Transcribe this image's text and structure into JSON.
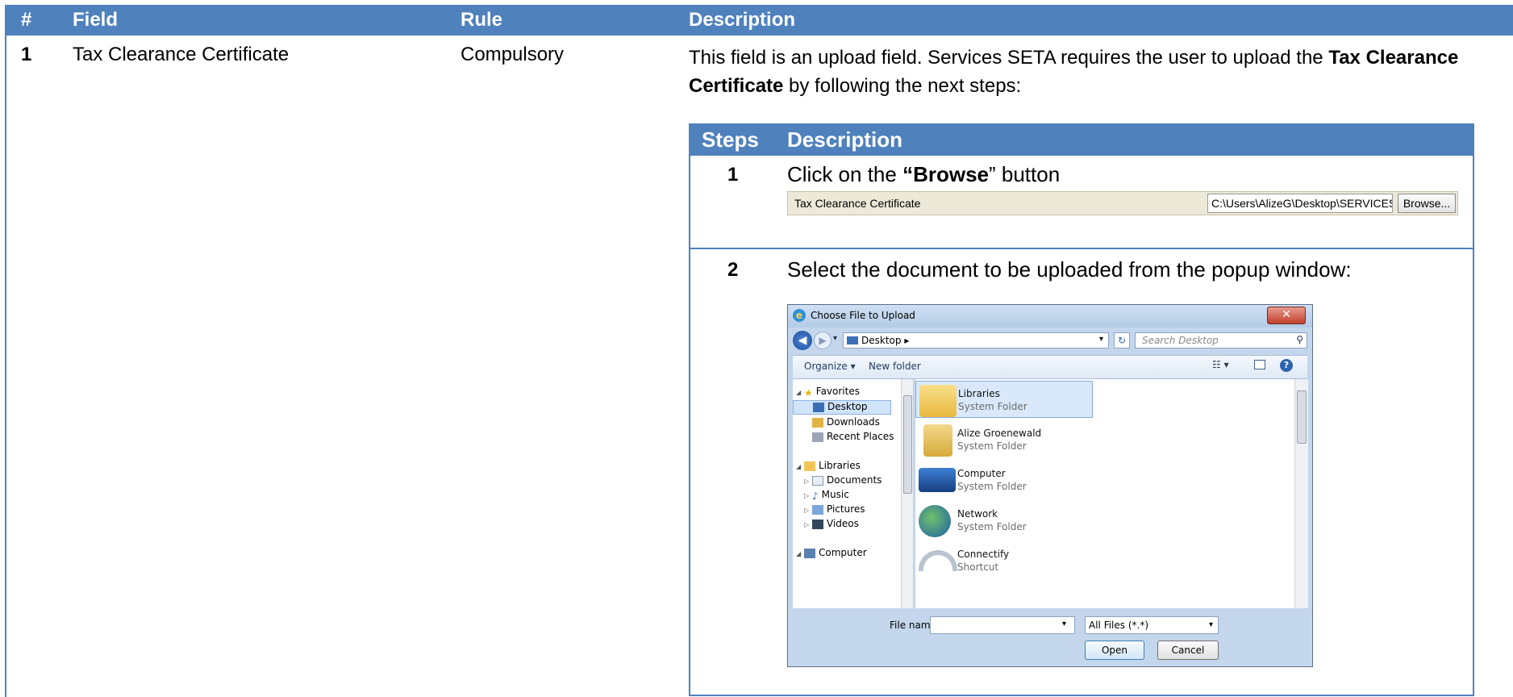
{
  "table": {
    "headers": [
      "#",
      "Field",
      "Rule",
      "Description"
    ],
    "row": {
      "number": "1",
      "field": "Tax Clearance Certificate",
      "rule": "Compulsory",
      "description_parts": [
        "This field is an upload field.  Services SETA requires the user to upload the ",
        "Tax Clearance Certificate",
        " by following the next steps:"
      ]
    }
  },
  "steps": {
    "headers": [
      "Steps",
      "Description"
    ],
    "step1": {
      "number": "1",
      "text_prefix": "Click on the ",
      "text_bold": "“Browse",
      "text_suffix": "” button",
      "upload_label": "Tax Clearance Certificate",
      "upload_path": "C:\\Users\\AlizeG\\Desktop\\SERVICES",
      "browse_label": "Browse..."
    },
    "step2": {
      "number": "2",
      "text": "Select the document to be uploaded from the popup window:"
    }
  },
  "dialog": {
    "title": "Choose File to Upload",
    "address": "Desktop",
    "search_placeholder": "Search Desktop",
    "toolbar": {
      "organize": "Organize ▾",
      "new_folder": "New folder"
    },
    "nav": {
      "favorites": "Favorites",
      "desktop": "Desktop",
      "downloads": "Downloads",
      "recent_places": "Recent Places",
      "libraries": "Libraries",
      "documents": "Documents",
      "music": "Music",
      "pictures": "Pictures",
      "videos": "Videos",
      "computer": "Computer"
    },
    "files": [
      {
        "name": "Libraries",
        "type": "System Folder"
      },
      {
        "name": "Alize Groenewald",
        "type": "System Folder"
      },
      {
        "name": "Computer",
        "type": "System Folder"
      },
      {
        "name": "Network",
        "type": "System Folder"
      },
      {
        "name": "Connectify",
        "type": "Shortcut"
      }
    ],
    "file_name_label": "File name:",
    "file_name_value": "",
    "file_type": "All Files (*.*)",
    "open_label": "Open",
    "cancel_label": "Cancel"
  },
  "colors": {
    "header_blue": "#4f81bd"
  }
}
